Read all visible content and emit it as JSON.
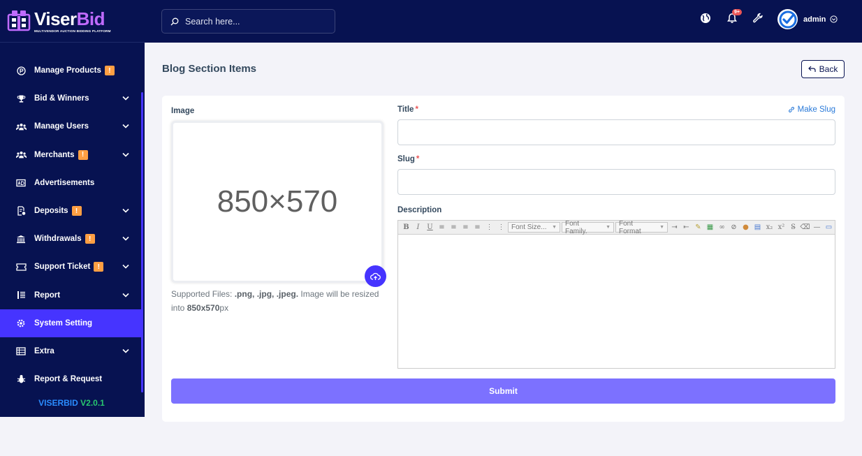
{
  "brand": {
    "name_part1": "Viser",
    "name_part2": "Bid",
    "tagline": "MULTIVENDOR AUCTION BIDDING PLATFORM"
  },
  "search": {
    "placeholder": "Search here..."
  },
  "topbar": {
    "notification_count": "9+",
    "admin_name": "admin"
  },
  "sidebar": {
    "items": [
      {
        "label": "Manage Products",
        "icon": "product-icon",
        "badge": "!",
        "chevron": false
      },
      {
        "label": "Bid & Winners",
        "icon": "trophy-icon",
        "badge": "",
        "chevron": true
      },
      {
        "label": "Manage Users",
        "icon": "users-icon",
        "badge": "",
        "chevron": true
      },
      {
        "label": "Merchants",
        "icon": "merchants-icon",
        "badge": "!",
        "chevron": true
      },
      {
        "label": "Advertisements",
        "icon": "ad-icon",
        "badge": "",
        "chevron": false
      },
      {
        "label": "Deposits",
        "icon": "deposit-icon",
        "badge": "!",
        "chevron": true
      },
      {
        "label": "Withdrawals",
        "icon": "bank-icon",
        "badge": "!",
        "chevron": true
      },
      {
        "label": "Support Ticket",
        "icon": "ticket-icon",
        "badge": "!",
        "chevron": true
      },
      {
        "label": "Report",
        "icon": "list-icon",
        "badge": "",
        "chevron": true
      },
      {
        "label": "System Setting",
        "icon": "cog-icon",
        "badge": "",
        "chevron": false
      },
      {
        "label": "Extra",
        "icon": "server-icon",
        "badge": "",
        "chevron": true
      },
      {
        "label": "Report & Request",
        "icon": "bug-icon",
        "badge": "",
        "chevron": false
      }
    ],
    "active_index": 9,
    "version_name": "VISERBID",
    "version_number": "V2.0.1"
  },
  "page": {
    "title": "Blog Section Items",
    "back_label": "Back"
  },
  "form": {
    "image_label": "Image",
    "image_placeholder": "850×570",
    "supported_prefix": "Supported Files: ",
    "supported_types": ".png, .jpg, .jpeg.",
    "supported_middle": " Image will be resized into ",
    "supported_size": "850x570",
    "supported_suffix": "px",
    "title_label": "Title",
    "title_value": "",
    "make_slug_label": "Make Slug",
    "slug_label": "Slug",
    "slug_value": "",
    "description_label": "Description",
    "required_mark": "*",
    "submit_label": "Submit"
  },
  "editor": {
    "font_size_label": "Font Size...",
    "font_family_label": "Font Family.",
    "font_format_label": "Font Format"
  },
  "colors": {
    "sidebar_bg": "#071251",
    "accent": "#4634ff",
    "submit_bg": "#7c71ff",
    "warning": "#ff9f43",
    "danger": "#ea5455",
    "link": "#2a7ad9"
  }
}
